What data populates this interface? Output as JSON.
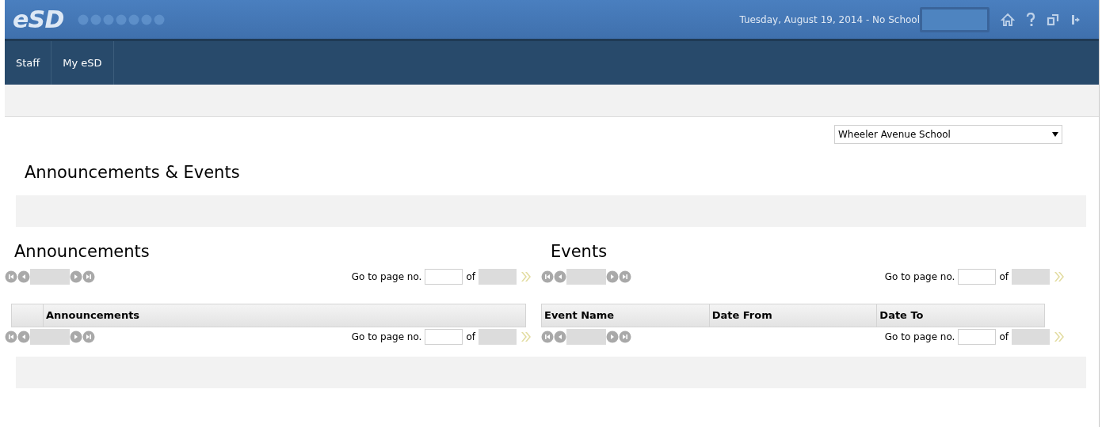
{
  "header": {
    "logo": "eSD",
    "date_status": "Tuesday, August 19, 2014 - No School"
  },
  "nav": [
    {
      "label": "Staff"
    },
    {
      "label": "My eSD"
    }
  ],
  "school_select": {
    "value": "Wheeler Avenue School"
  },
  "page_title": "Announcements & Events",
  "panels": [
    {
      "title": "Announcements",
      "select_column": true,
      "columns": [
        "Announcements"
      ],
      "pagers": [
        {
          "go_to": "Go to page no.",
          "of": "of"
        },
        {
          "go_to": "Go to page no.",
          "of": "of"
        }
      ]
    },
    {
      "title": "Events",
      "select_column": false,
      "columns": [
        "Event Name",
        "Date From",
        "Date To"
      ],
      "pagers": [
        {
          "go_to": "Go to page no.",
          "of": "of"
        },
        {
          "go_to": "Go to page no.",
          "of": "of"
        }
      ]
    }
  ]
}
